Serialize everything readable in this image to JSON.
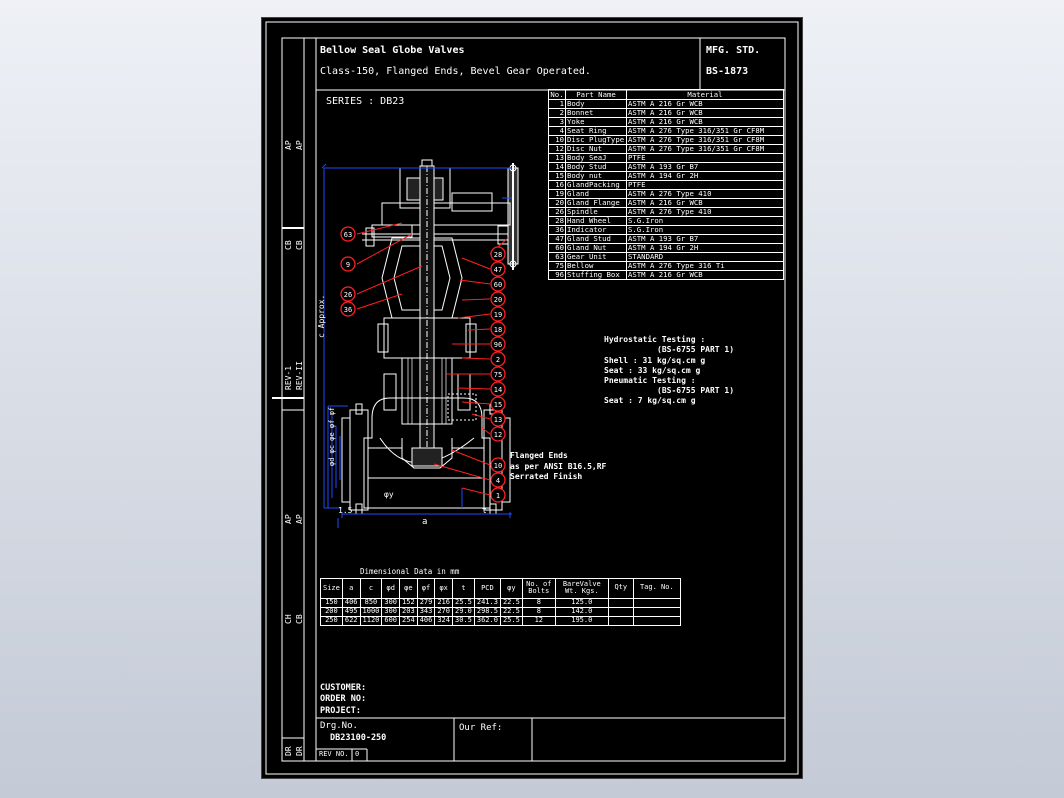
{
  "title_block": {
    "title_line1": "Bellow Seal Globe Valves",
    "title_line2": "Class-150, Flanged Ends, Bevel Gear Operated.",
    "mfg_label": "MFG. STD.",
    "mfg_value": "BS-1873",
    "series": "SERIES : DB23"
  },
  "side_labels": {
    "ap": "AP",
    "cb": "CB",
    "rev1": "REV-1",
    "rev2": "REV-II",
    "ch": "CH",
    "dr": "DR",
    "approx": "c Approx."
  },
  "parts_table": {
    "headers": [
      "No.",
      "Part Name",
      "Material"
    ],
    "rows": [
      [
        "1",
        "Body",
        "ASTM A 216 Gr WCB"
      ],
      [
        "2",
        "Bonnet",
        "ASTM A 216 Gr WCB"
      ],
      [
        "3",
        "Yoke",
        "ASTM A 216 Gr WCB"
      ],
      [
        "4",
        "Seat Ring",
        "ASTM A 276 Type 316/351 Gr CF8M"
      ],
      [
        "10",
        "Disc PlugType",
        "ASTM A 276 Type 316/351 Gr CF8M"
      ],
      [
        "12",
        "Disc Nut",
        "ASTM A 276 Type 316/351 Gr CF8M"
      ],
      [
        "13",
        "Body SeaJ",
        "PTFE"
      ],
      [
        "14",
        "Body Stud",
        "ASTM A 193 Gr B7"
      ],
      [
        "15",
        "Body nut",
        "ASTM A 194 Gr 2H"
      ],
      [
        "16",
        "GlandPacking",
        "PTFE"
      ],
      [
        "19",
        "Gland",
        "ASTM A 276 Type 410"
      ],
      [
        "20",
        "Gland Flange",
        "ASTM A 216 Gr WCB"
      ],
      [
        "26",
        "Spindle",
        "ASTM A 276 Type 410"
      ],
      [
        "28",
        "Hand Wheel",
        "S.G.Iron"
      ],
      [
        "36",
        "Indicator",
        "S.G.Iron"
      ],
      [
        "47",
        "Gland Stud",
        "ASTM A 193 Gr B7"
      ],
      [
        "60",
        "Gland Nut",
        "ASTM A 194 Gr 2H"
      ],
      [
        "63",
        "Gear Unit",
        "STANDARD"
      ],
      [
        "75",
        "Bellow",
        "ASTM A 276 Type 316 Ti"
      ],
      [
        "96",
        "Stuffing Box",
        "ASTM A 216 Gr WCB"
      ]
    ]
  },
  "testing": {
    "l1": "Hydrostatic Testing :",
    "l2": "(BS-6755 PART 1)",
    "l3": "Shell : 31 kg/sq.cm g",
    "l4": "Seat  : 33 kg/sq.cm g",
    "l5": "Pneumatic Testing :",
    "l6": "(BS-6755 PART 1)",
    "l7": "Seat : 7 kg/sq.cm g"
  },
  "flange_note": {
    "l1": "Flanged Ends",
    "l2": "as per ANSI B16.5,RF",
    "l3": "Serrated Finish"
  },
  "balloons_left": [
    "63",
    "9",
    "26",
    "36"
  ],
  "balloons_right": [
    "28",
    "47",
    "60",
    "20",
    "19",
    "18",
    "96",
    "2",
    "75",
    "14",
    "15",
    "13",
    "12",
    "10",
    "4",
    "1"
  ],
  "dims": {
    "d15": "1.5",
    "a": "a",
    "t": "t",
    "phiy": "φy",
    "dims_rot": "φd φc φe φf φf"
  },
  "dim_table": {
    "title": "Dimensional Data in mm",
    "headers": [
      "Size",
      "a",
      "c",
      "φd",
      "φe",
      "φf",
      "φx",
      "t",
      "PCD",
      "φy"
    ],
    "rows": [
      [
        "150",
        "406",
        "850",
        "300",
        "152",
        "279",
        "216",
        "25.5",
        "241.3",
        "22.5"
      ],
      [
        "200",
        "495",
        "1000",
        "300",
        "203",
        "343",
        "270",
        "29.0",
        "298.5",
        "22.5"
      ],
      [
        "250",
        "622",
        "1120",
        "600",
        "254",
        "406",
        "324",
        "30.5",
        "362.0",
        "25.5"
      ]
    ],
    "bolts_header": "No. of Bolts",
    "bolts": [
      "8",
      "8",
      "12"
    ],
    "weight_header": "BareValve Wt. Kgs.",
    "weights": [
      "125.0",
      "142.0",
      "195.0"
    ],
    "qty_header": "Qty",
    "tag_header": "Tag. No."
  },
  "footer": {
    "customer": "CUSTOMER:",
    "order": "ORDER NO:",
    "project": "PROJECT:",
    "drg_label": "Drg.No.",
    "drg_value": "DB23100-250",
    "our_ref": "Our Ref:",
    "rev_no": "REV NO.",
    "rev_val": "0"
  },
  "colors": {
    "background": "#000000",
    "line": "#ffffff",
    "accent": "#ff2020",
    "dim": "#1e4bff"
  }
}
